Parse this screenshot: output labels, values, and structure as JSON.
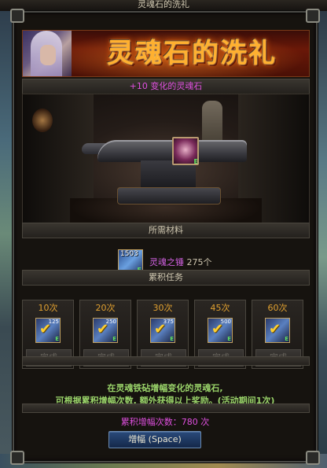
{
  "window": {
    "title": "灵魂石的洗礼"
  },
  "banner": {
    "title": "灵魂石的洗礼"
  },
  "item": {
    "name": "+10 变化的灵魂石"
  },
  "materials": {
    "header": "所需材料",
    "item_count": "1503",
    "item_name": "灵魂之锤",
    "item_qty": "275个"
  },
  "tasks": {
    "header": "累积任务",
    "items": [
      {
        "label": "10次",
        "icon_num": "125",
        "button": "完成"
      },
      {
        "label": "20次",
        "icon_num": "250",
        "button": "完成"
      },
      {
        "label": "30次",
        "icon_num": "375",
        "button": "完成"
      },
      {
        "label": "45次",
        "icon_num": "500",
        "button": "完成"
      },
      {
        "label": "60次",
        "icon_num": "",
        "button": "完成"
      }
    ]
  },
  "description": {
    "line1": "在灵魂铁砧增幅变化的灵魂石,",
    "line2": "可根据累积增幅次数, 额外获得以上奖励。(活动期间1次)"
  },
  "total": {
    "text": "累积增幅次数：780 次"
  },
  "enhance_button": {
    "label": "增幅 (Space)"
  },
  "colors": {
    "accent_magenta": "#e050e0",
    "title_orange": "#ffb030",
    "task_gold": "#e0a030",
    "desc_green": "#9ad46a"
  },
  "icons": {
    "slot": "soul-stone-icon",
    "material": "soul-hammer-icon",
    "task": "reward-box-icon"
  }
}
